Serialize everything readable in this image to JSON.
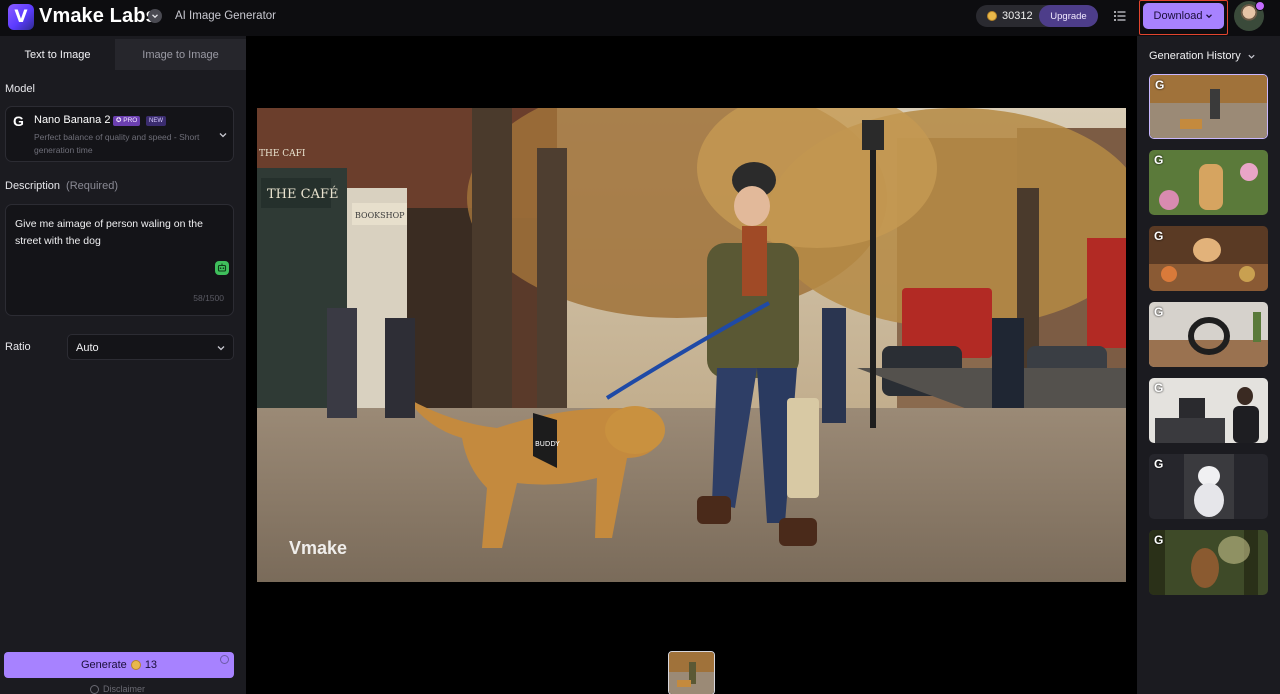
{
  "app": {
    "logo_letter": "V",
    "brand": "Vmake Labs",
    "subtitle": "AI Image Generator"
  },
  "header": {
    "credits": "30312",
    "upgrade_label": "Upgrade",
    "download_label": "Download"
  },
  "left_panel": {
    "tabs": [
      {
        "label": "Text to Image",
        "active": true
      },
      {
        "label": "Image to Image",
        "active": false
      }
    ],
    "model_label": "Model",
    "model": {
      "icon_letter": "G",
      "name": "Nano Banana 2",
      "badge_pro": "✪ PRO",
      "badge_new": "NEW",
      "description": "Perfect balance of quality and speed - Short generation time"
    },
    "description_label": "Description",
    "description_required": "(Required)",
    "description_value": "Give me aimage of person waling on the street with the dog",
    "char_count": "58/1500",
    "ratio_label": "Ratio",
    "ratio_value": "Auto",
    "generate_label": "Generate",
    "generate_cost": "13",
    "disclaimer": "Disclaimer"
  },
  "main": {
    "watermark": "Vmake",
    "sign_cafe": "THE CAFÉ",
    "sign_bookshop": "BOOKSHOP",
    "sign_the": "THE CAFI",
    "harness_text": "BUDDY"
  },
  "history": {
    "title": "Generation History",
    "items": [
      {
        "icon_letter": "G",
        "subject": "street-dog-walk",
        "selected": true
      },
      {
        "icon_letter": "G",
        "subject": "golden-retriever-garden",
        "selected": false
      },
      {
        "icon_letter": "G",
        "subject": "dog-chef-feast",
        "selected": false
      },
      {
        "icon_letter": "G",
        "subject": "headphones-desk",
        "selected": false
      },
      {
        "icon_letter": "G",
        "subject": "office-worker",
        "selected": false
      },
      {
        "icon_letter": "G",
        "subject": "white-dog-sitting",
        "selected": false
      },
      {
        "icon_letter": "G",
        "subject": "forest-creature",
        "selected": false
      }
    ]
  },
  "colors": {
    "accent": "#a782ff",
    "highlight_outline": "#e2452e",
    "panel_bg": "#1b1b20",
    "canvas_bg": "#000000"
  }
}
